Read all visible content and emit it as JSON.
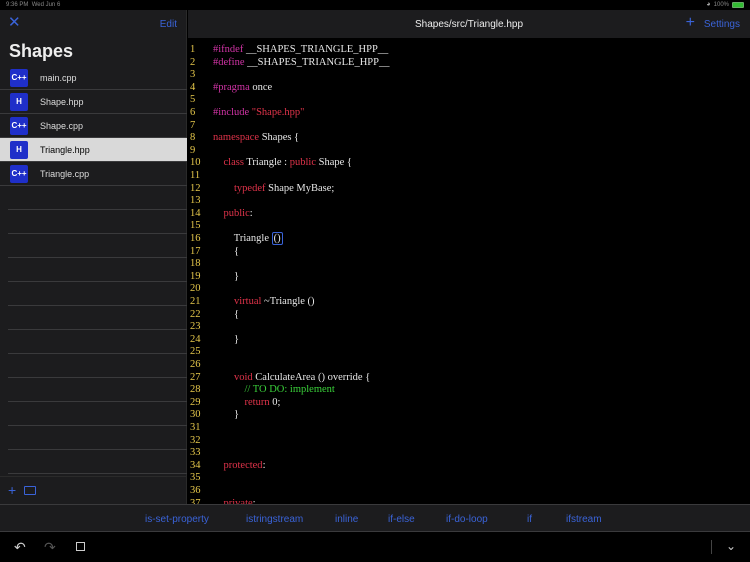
{
  "status": {
    "time": "9:36 PM",
    "date": "Wed Jun 6",
    "battery": "100%"
  },
  "sidebar": {
    "close_icon": "close-icon",
    "edit_label": "Edit",
    "title": "Shapes",
    "files": [
      {
        "name": "main.cpp",
        "icon": "C++"
      },
      {
        "name": "Shape.hpp",
        "icon": "H"
      },
      {
        "name": "Shape.cpp",
        "icon": "C++"
      },
      {
        "name": "Triangle.hpp",
        "icon": "H"
      },
      {
        "name": "Triangle.cpp",
        "icon": "C++"
      }
    ],
    "selected_index": 3
  },
  "editor": {
    "title": "Shapes/src/Triangle.hpp",
    "settings_label": "Settings",
    "lines": [
      {
        "n": "1",
        "parts": [
          [
            "pp",
            "#ifndef"
          ],
          [
            "t",
            " __SHAPES_TRIANGLE_HPP__"
          ]
        ]
      },
      {
        "n": "2",
        "parts": [
          [
            "pp",
            "#define"
          ],
          [
            "t",
            " __SHAPES_TRIANGLE_HPP__"
          ]
        ]
      },
      {
        "n": "3",
        "parts": []
      },
      {
        "n": "4",
        "parts": [
          [
            "pp",
            "#pragma"
          ],
          [
            "t",
            " once"
          ]
        ]
      },
      {
        "n": "5",
        "parts": []
      },
      {
        "n": "6",
        "parts": [
          [
            "pp",
            "#include"
          ],
          [
            "t",
            " "
          ],
          [
            "str",
            "\"Shape.hpp\""
          ]
        ]
      },
      {
        "n": "7",
        "parts": []
      },
      {
        "n": "8",
        "parts": [
          [
            "kw",
            "namespace"
          ],
          [
            "t",
            " Shapes {"
          ]
        ]
      },
      {
        "n": "9",
        "parts": []
      },
      {
        "n": "10",
        "parts": [
          [
            "t",
            "    "
          ],
          [
            "kw",
            "class"
          ],
          [
            "t",
            " Triangle : "
          ],
          [
            "kw",
            "public"
          ],
          [
            "t",
            " Shape {"
          ]
        ]
      },
      {
        "n": "11",
        "parts": []
      },
      {
        "n": "12",
        "parts": [
          [
            "t",
            "        "
          ],
          [
            "kw",
            "typedef"
          ],
          [
            "t",
            " Shape MyBase;"
          ]
        ]
      },
      {
        "n": "13",
        "parts": []
      },
      {
        "n": "14",
        "parts": [
          [
            "t",
            "    "
          ],
          [
            "kw",
            "public"
          ],
          [
            "t",
            ":"
          ]
        ]
      },
      {
        "n": "15",
        "parts": []
      },
      {
        "n": "16",
        "parts": [
          [
            "t",
            "        Triangle "
          ],
          [
            "cur",
            "()"
          ]
        ]
      },
      {
        "n": "17",
        "parts": [
          [
            "t",
            "        {"
          ]
        ]
      },
      {
        "n": "18",
        "parts": []
      },
      {
        "n": "19",
        "parts": [
          [
            "t",
            "        }"
          ]
        ]
      },
      {
        "n": "20",
        "parts": []
      },
      {
        "n": "21",
        "parts": [
          [
            "t",
            "        "
          ],
          [
            "kw",
            "virtual"
          ],
          [
            "t",
            " ~Triangle ()"
          ]
        ]
      },
      {
        "n": "22",
        "parts": [
          [
            "t",
            "        {"
          ]
        ]
      },
      {
        "n": "23",
        "parts": []
      },
      {
        "n": "24",
        "parts": [
          [
            "t",
            "        }"
          ]
        ]
      },
      {
        "n": "25",
        "parts": []
      },
      {
        "n": "26",
        "parts": []
      },
      {
        "n": "27",
        "parts": [
          [
            "t",
            "        "
          ],
          [
            "kw",
            "void"
          ],
          [
            "t",
            " CalculateArea () override {"
          ]
        ]
      },
      {
        "n": "28",
        "parts": [
          [
            "t",
            "            "
          ],
          [
            "cm",
            "// TO DO: implement"
          ]
        ]
      },
      {
        "n": "29",
        "parts": [
          [
            "t",
            "            "
          ],
          [
            "kw",
            "return"
          ],
          [
            "t",
            " 0;"
          ]
        ]
      },
      {
        "n": "30",
        "parts": [
          [
            "t",
            "        }"
          ]
        ]
      },
      {
        "n": "31",
        "parts": []
      },
      {
        "n": "32",
        "parts": []
      },
      {
        "n": "33",
        "parts": []
      },
      {
        "n": "34",
        "parts": [
          [
            "t",
            "    "
          ],
          [
            "kw",
            "protected"
          ],
          [
            "t",
            ":"
          ]
        ]
      },
      {
        "n": "35",
        "parts": []
      },
      {
        "n": "36",
        "parts": []
      },
      {
        "n": "37",
        "parts": [
          [
            "t",
            "    "
          ],
          [
            "kw",
            "private"
          ],
          [
            "t",
            ":"
          ]
        ]
      }
    ]
  },
  "snippets": [
    "is-set-property",
    "istringstream",
    "inline",
    "if-else",
    "if-do-loop",
    "if",
    "ifstream"
  ],
  "colors": {
    "accent": "#3a63d8",
    "keyword": "#e0334a",
    "preprocessor": "#d033a5",
    "comment": "#3ad13a",
    "line_number": "#e6c84b"
  }
}
